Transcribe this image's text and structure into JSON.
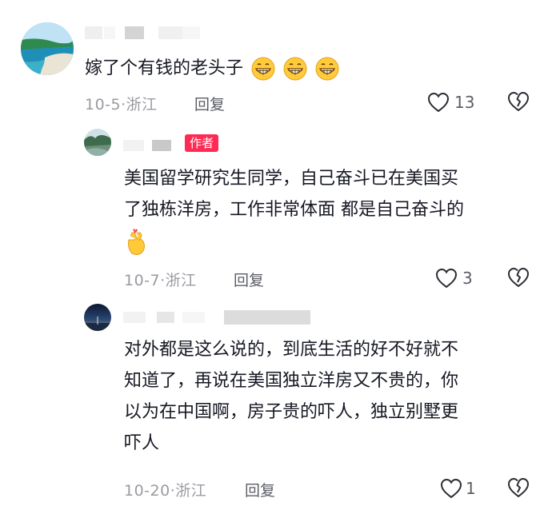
{
  "comments": [
    {
      "text": "嫁了个有钱的老头子",
      "date_location": "10-5·浙江",
      "reply_label": "回复",
      "like_count": "13"
    },
    {
      "author_badge": "作者",
      "text_line1": "美国留学研究生同学，自己奋斗已在美国买",
      "text_line2": "了独栋洋房，工作非常体面 都是自己奋斗的",
      "date_location": "10-7·浙江",
      "reply_label": "回复",
      "like_count": "3"
    },
    {
      "text_line1": "对外都是这么说的，到底生活的好不好就不",
      "text_line2": "知道了，再说在美国独立洋房又不贵的，你",
      "text_line3": "以为在中国啊，房子贵的吓人，独立别墅更",
      "text_line4": "吓人",
      "date_location": "10-20·浙江",
      "reply_label": "回复",
      "like_count": "1"
    }
  ],
  "icons": {
    "like": "heart-outline-icon",
    "dislike": "broken-heart-icon",
    "grin": "grinning-face-emoji",
    "finger_heart": "finger-heart-emoji"
  },
  "colors": {
    "author_badge": "#fe2c55",
    "text": "#161823",
    "meta": "#9a9ba1"
  }
}
